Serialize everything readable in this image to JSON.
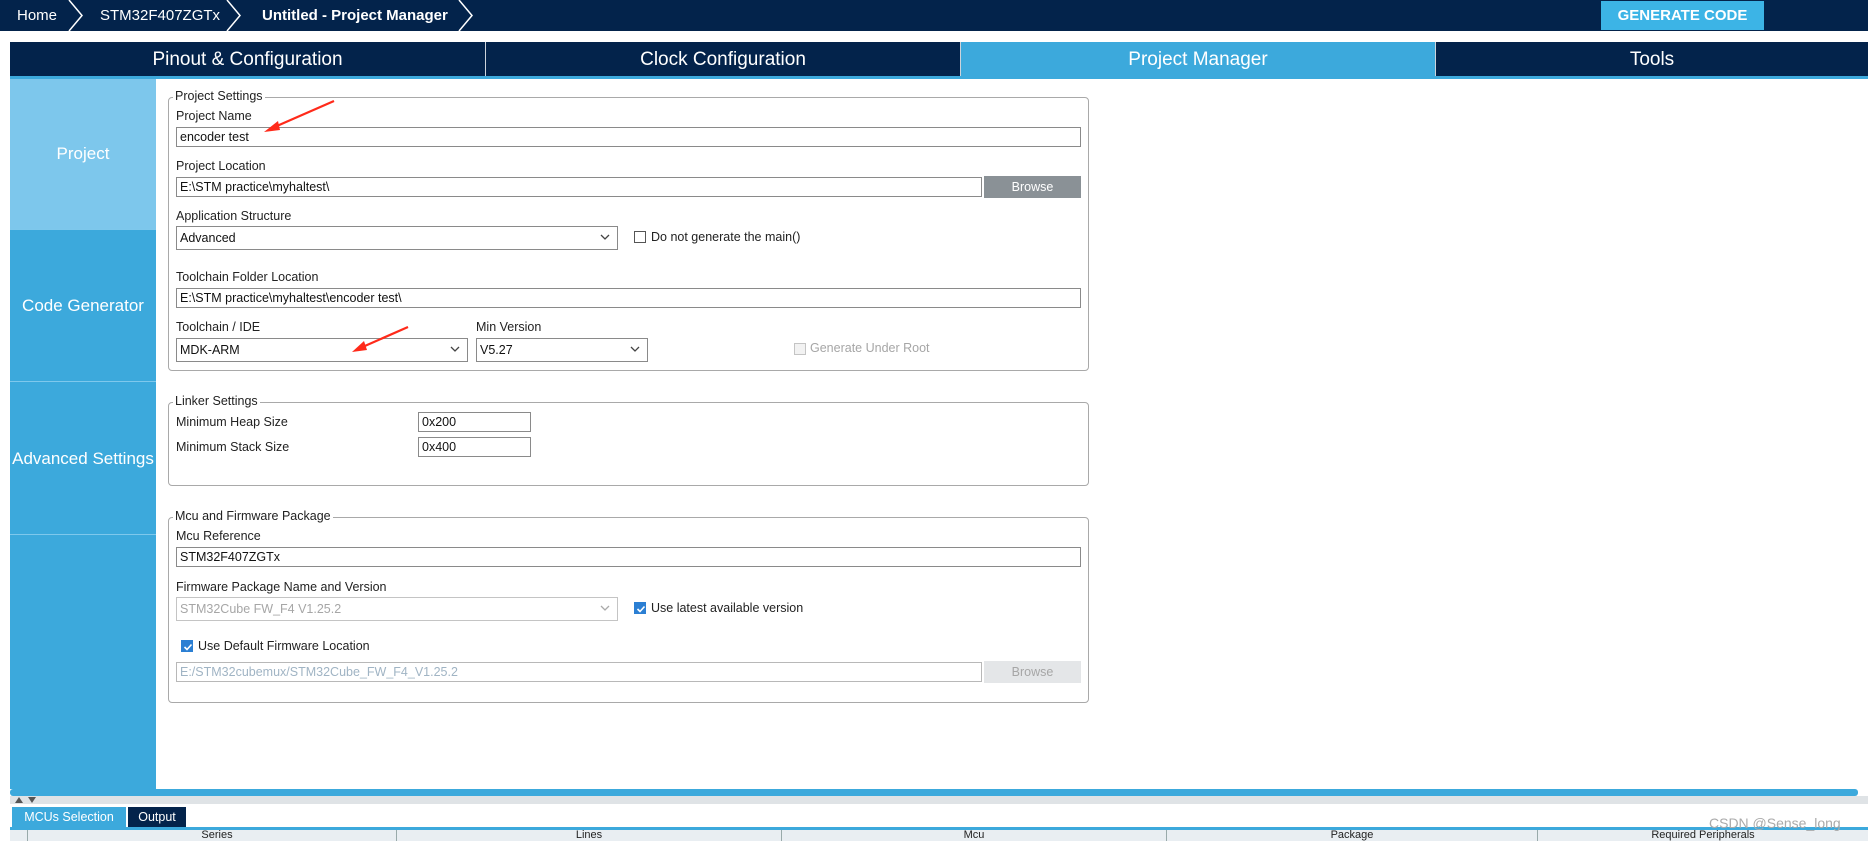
{
  "breadcrumb": {
    "home": "Home",
    "device": "STM32F407ZGTx",
    "current": "Untitled - Project Manager"
  },
  "generate_code_label": "GENERATE CODE",
  "tabs": [
    {
      "label": "Pinout & Configuration"
    },
    {
      "label": "Clock Configuration"
    },
    {
      "label": "Project Manager"
    },
    {
      "label": "Tools"
    }
  ],
  "active_tab": "Project Manager",
  "sidebar": {
    "items": [
      {
        "label": "Project"
      },
      {
        "label": "Code Generator"
      },
      {
        "label": "Advanced Settings"
      }
    ],
    "active": "Project"
  },
  "project_settings": {
    "legend": "Project Settings",
    "project_name_label": "Project Name",
    "project_name_value": "encoder test",
    "project_location_label": "Project Location",
    "project_location_value": "E:\\STM practice\\myhaltest\\",
    "browse_label": "Browse",
    "app_structure_label": "Application Structure",
    "app_structure_value": "Advanced",
    "no_main_label": "Do not generate the main()",
    "no_main_checked": false,
    "toolchain_folder_label": "Toolchain Folder Location",
    "toolchain_folder_value": "E:\\STM practice\\myhaltest\\encoder test\\",
    "toolchain_ide_label": "Toolchain / IDE",
    "toolchain_ide_value": "MDK-ARM",
    "min_version_label": "Min Version",
    "min_version_value": "V5.27",
    "generate_under_root_label": "Generate Under Root",
    "generate_under_root_checked": false
  },
  "linker_settings": {
    "legend": "Linker Settings",
    "heap_label": "Minimum Heap Size",
    "heap_value": "0x200",
    "stack_label": "Minimum Stack Size",
    "stack_value": "0x400"
  },
  "mcu_firmware": {
    "legend": "Mcu and Firmware Package",
    "mcu_ref_label": "Mcu Reference",
    "mcu_ref_value": "STM32F407ZGTx",
    "fw_label": "Firmware Package Name and Version",
    "fw_value": "STM32Cube FW_F4 V1.25.2",
    "use_latest_label": "Use latest available version",
    "use_latest_checked": true,
    "use_default_loc_label": "Use Default Firmware Location",
    "use_default_loc_checked": true,
    "fw_location_value": "E:/STM32cubemux/STM32Cube_FW_F4_V1.25.2",
    "browse_label": "Browse"
  },
  "bottom_tabs": [
    {
      "label": "MCUs Selection"
    },
    {
      "label": "Output"
    }
  ],
  "table_headers": [
    "Series",
    "Lines",
    "Mcu",
    "Package",
    "Required Peripherals"
  ],
  "watermark": "CSDN @Sense_long",
  "colors": {
    "navy": "#03234b",
    "accent": "#3ca9dc",
    "generate_button": "#3cb4e6",
    "annotation_arrow": "#ff2a1a"
  }
}
